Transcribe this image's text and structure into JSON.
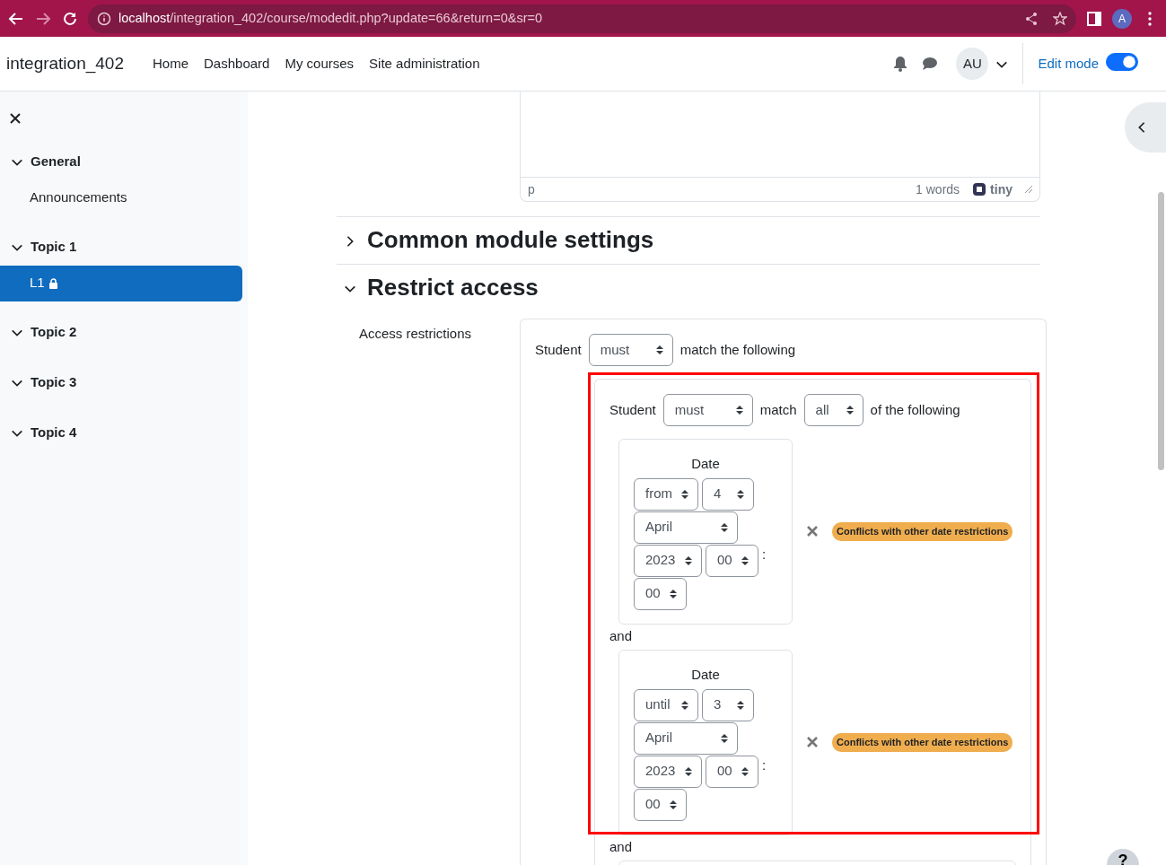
{
  "browser": {
    "url_host": "localhost",
    "url_path": "/integration_402/course/modedit.php?update=66&return=0&sr=0",
    "profile": "A"
  },
  "navbar": {
    "brand": "integration_402",
    "links": [
      "Home",
      "Dashboard",
      "My courses",
      "Site administration"
    ],
    "avatar": "AU",
    "edit_mode": {
      "label": "Edit mode",
      "on": true
    }
  },
  "sidebar": {
    "items": [
      {
        "label": "General",
        "expanded": true,
        "children": [
          {
            "label": "Announcements",
            "selected": false,
            "locked": false
          }
        ]
      },
      {
        "label": "Topic 1",
        "expanded": true,
        "children": [
          {
            "label": "L1",
            "selected": true,
            "locked": true
          }
        ]
      },
      {
        "label": "Topic 2",
        "expanded": true
      },
      {
        "label": "Topic 3",
        "expanded": true
      },
      {
        "label": "Topic 4",
        "expanded": true
      }
    ]
  },
  "editor": {
    "status_path": "p",
    "word_count": "1 words",
    "brand": "tiny"
  },
  "sections": [
    {
      "title": "Common module settings",
      "expanded": false
    },
    {
      "title": "Restrict access",
      "expanded": true
    }
  ],
  "restrict": {
    "label": "Access restrictions",
    "root": {
      "prefix": "Student",
      "must": "must",
      "suffix": "match the following"
    },
    "group": {
      "prefix": "Student",
      "must": "must",
      "match": "match",
      "all": "all",
      "suffix": "of the following",
      "conditions": [
        {
          "title": "Date",
          "direction": "from",
          "day": "4",
          "month": "April",
          "year": "2023",
          "hour": "00",
          "minute": "00",
          "separator": ":",
          "warning": "Conflicts with other date restrictions",
          "joiner": "and"
        },
        {
          "title": "Date",
          "direction": "until",
          "day": "3",
          "month": "April",
          "year": "2023",
          "hour": "00",
          "minute": "00",
          "separator": ":",
          "warning": "Conflicts with other date restrictions",
          "joiner": "and"
        }
      ]
    }
  },
  "help": "?"
}
